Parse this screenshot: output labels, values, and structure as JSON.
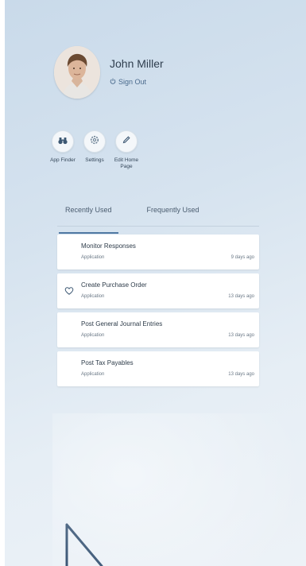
{
  "user": {
    "name": "John Miller",
    "sign_out_label": "Sign Out"
  },
  "actions": [
    {
      "label": "App Finder",
      "icon": "binoculars-icon"
    },
    {
      "label": "Settings",
      "icon": "gear-icon"
    },
    {
      "label": "Edit Home Page",
      "icon": "pencil-icon"
    }
  ],
  "tabs": [
    {
      "label": "Recently Used",
      "active": true
    },
    {
      "label": "Frequently Used",
      "active": false
    }
  ],
  "items": [
    {
      "title": "Monitor Responses",
      "type": "Application",
      "time": "9 days ago",
      "favorite": false
    },
    {
      "title": "Create Purchase Order",
      "type": "Application",
      "time": "13 days ago",
      "favorite": true
    },
    {
      "title": "Post General Journal Entries",
      "type": "Application",
      "time": "13 days ago",
      "favorite": false
    },
    {
      "title": "Post Tax Payables",
      "type": "Application",
      "time": "13 days ago",
      "favorite": false
    }
  ],
  "colors": {
    "accent": "#5079a3",
    "panel_top": "#c9daea",
    "panel_bottom": "#edf2f7"
  }
}
